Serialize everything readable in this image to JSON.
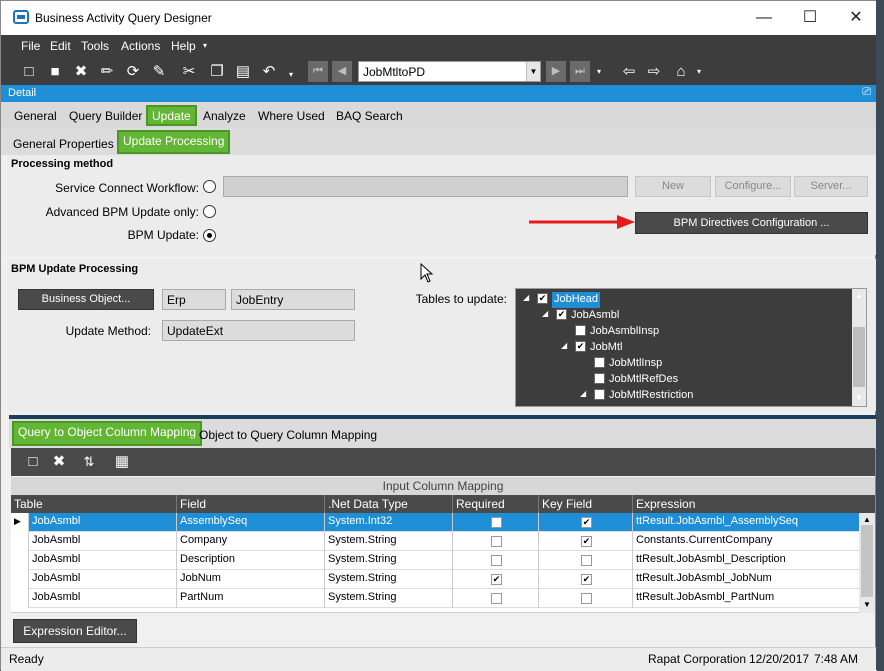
{
  "window": {
    "title": "Business Activity Query Designer"
  },
  "menu": [
    "File",
    "Edit",
    "Tools",
    "Actions",
    "Help"
  ],
  "toolbar": {
    "query_id": "JobMtltoPD"
  },
  "detail": {
    "label": "Detail"
  },
  "tabs": {
    "primary": [
      "General",
      "Query Builder",
      "Update",
      "Analyze",
      "Where Used",
      "BAQ Search"
    ],
    "secondary": [
      "General Properties",
      "Update  Processing"
    ]
  },
  "processing_method": {
    "title": "Processing method",
    "service_connect_label": "Service Connect Workflow:",
    "advanced_bpm_label": "Advanced BPM Update only:",
    "bpm_update_label": "BPM Update:",
    "new_btn": "New",
    "configure_btn": "Configure...",
    "server_btn": "Server...",
    "bpm_directives_btn": "BPM Directives Configuration ..."
  },
  "bpm_update_processing": {
    "title": "BPM Update Processing",
    "business_object_btn": "Business Object...",
    "erp": "Erp",
    "business_object": "JobEntry",
    "update_method_label": "Update Method:",
    "update_method": "UpdateExt",
    "tables_label": "Tables to update:",
    "tree": [
      {
        "label": "JobHead",
        "checked": true,
        "level": 0,
        "expand": true,
        "selected": true
      },
      {
        "label": "JobAsmbl",
        "checked": true,
        "level": 1,
        "expand": true
      },
      {
        "label": "JobAsmblInsp",
        "checked": false,
        "level": 2,
        "expand": false
      },
      {
        "label": "JobMtl",
        "checked": true,
        "level": 2,
        "expand": true
      },
      {
        "label": "JobMtlInsp",
        "checked": false,
        "level": 3,
        "expand": false
      },
      {
        "label": "JobMtlRefDes",
        "checked": false,
        "level": 3,
        "expand": false
      },
      {
        "label": "JobMtlRestriction",
        "checked": false,
        "level": 3,
        "expand": true
      }
    ]
  },
  "mapping_tabs": [
    "Query to Object Column Mapping",
    "Object to Query Column Mapping"
  ],
  "grid": {
    "caption": "Input Column Mapping",
    "columns": [
      "Table",
      "Field",
      ".Net Data Type",
      "Required",
      "Key Field",
      "Expression"
    ],
    "rows": [
      {
        "table": "JobAsmbl",
        "field": "AssemblySeq",
        "type": "System.Int32",
        "required": false,
        "key": true,
        "expr": "ttResult.JobAsmbl_AssemblySeq"
      },
      {
        "table": "JobAsmbl",
        "field": "Company",
        "type": "System.String",
        "required": false,
        "key": true,
        "expr": "Constants.CurrentCompany"
      },
      {
        "table": "JobAsmbl",
        "field": "Description",
        "type": "System.String",
        "required": false,
        "key": false,
        "expr": "ttResult.JobAsmbl_Description"
      },
      {
        "table": "JobAsmbl",
        "field": "JobNum",
        "type": "System.String",
        "required": true,
        "key": true,
        "expr": "ttResult.JobAsmbl_JobNum"
      },
      {
        "table": "JobAsmbl",
        "field": "PartNum",
        "type": "System.String",
        "required": false,
        "key": false,
        "expr": "ttResult.JobAsmbl_PartNum"
      }
    ]
  },
  "expression_editor_btn": "Expression Editor...",
  "status": {
    "left": "Ready",
    "company": "Rapat Corporation",
    "date": "12/20/2017",
    "time": "7:48 AM"
  }
}
